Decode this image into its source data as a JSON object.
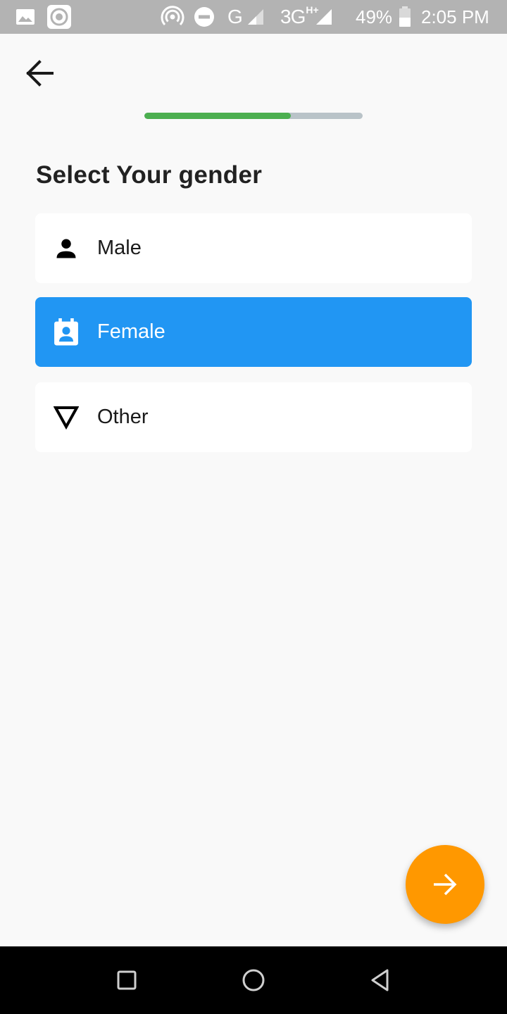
{
  "status_bar": {
    "network_g": "G",
    "network_3g": "3G",
    "network_3g_sup": "H+",
    "battery_percent": "49%",
    "time": "2:05 PM",
    "icons": [
      "image-icon",
      "sync-icon",
      "hotspot-icon",
      "do-not-disturb-icon",
      "signal-icon",
      "signal-icon",
      "battery-icon"
    ]
  },
  "header": {
    "back_icon": "arrow-left-icon"
  },
  "progress": {
    "value": 0.67,
    "fill_color": "#4caf50",
    "track_color": "#b9c3c8"
  },
  "page": {
    "title": "Select Your gender"
  },
  "options": [
    {
      "label": "Male",
      "icon": "person-icon",
      "selected": false
    },
    {
      "label": "Female",
      "icon": "contact-calendar-icon",
      "selected": true
    },
    {
      "label": "Other",
      "icon": "triangle-down-icon",
      "selected": false
    }
  ],
  "colors": {
    "selected_bg": "#2196f3",
    "fab_bg": "#ff9800",
    "background": "#f9f9f9"
  },
  "fab": {
    "icon": "arrow-right-icon"
  },
  "nav_bar": {
    "icons": [
      "recent-apps-icon",
      "home-icon",
      "back-triangle-icon"
    ]
  }
}
